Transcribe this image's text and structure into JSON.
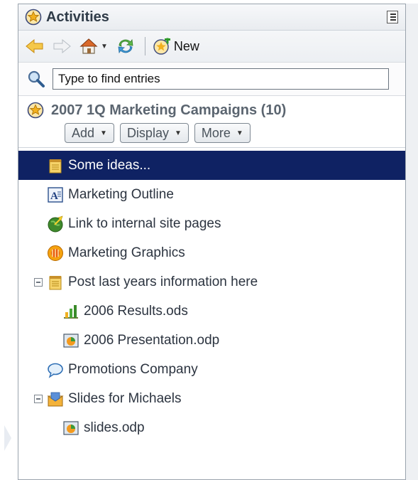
{
  "panel": {
    "title": "Activities"
  },
  "toolbar": {
    "new_label": "New"
  },
  "search": {
    "placeholder": "Type to find entries"
  },
  "activity": {
    "title": "2007 1Q Marketing Campaigns (10)",
    "actions": [
      {
        "label": "Add"
      },
      {
        "label": "Display"
      },
      {
        "label": "More"
      }
    ]
  },
  "entries": [
    {
      "label": "Some ideas...",
      "icon": "notepad-icon",
      "selected": true
    },
    {
      "label": "Marketing Outline",
      "icon": "text-document-icon"
    },
    {
      "label": "Link to internal site pages",
      "icon": "globe-link-icon"
    },
    {
      "label": "Marketing Graphics",
      "icon": "graphics-icon"
    },
    {
      "label": "Post last years information here",
      "icon": "notepad-icon",
      "expanded": true
    },
    {
      "label": "2006 Results.ods",
      "icon": "spreadsheet-icon"
    },
    {
      "label": "2006 Presentation.odp",
      "icon": "presentation-icon"
    },
    {
      "label": "Promotions Company",
      "icon": "chat-bubble-icon"
    },
    {
      "label": "Slides for Michaels",
      "icon": "mail-folder-icon",
      "expanded": true
    },
    {
      "label": "slides.odp",
      "icon": "presentation-icon"
    }
  ],
  "colors": {
    "selected_row": "#0f2263",
    "title_text": "#2f3b48",
    "activity_title": "#5b6570"
  }
}
